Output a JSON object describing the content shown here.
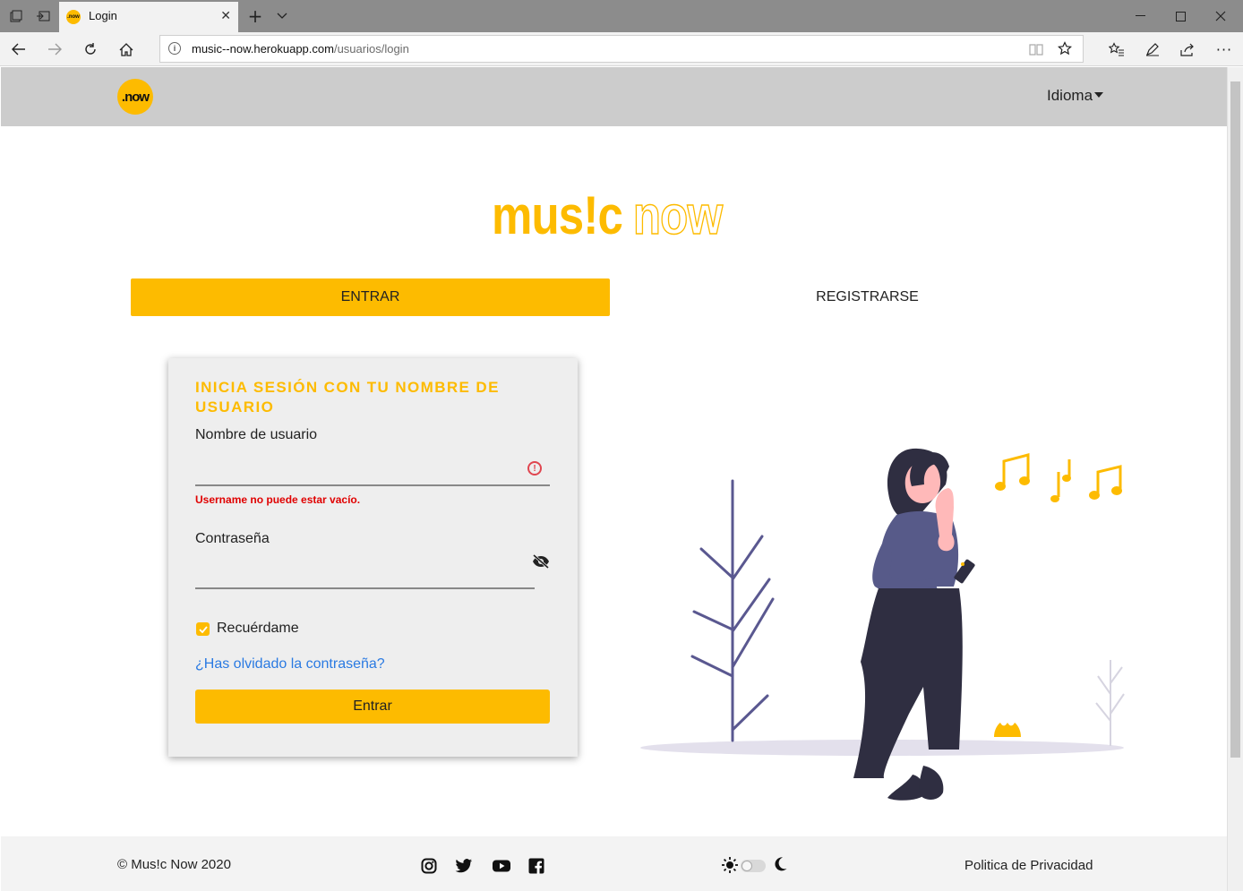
{
  "browser": {
    "tab_title": "Login",
    "favicon_text": ".now",
    "url_domain": "music--now.herokuapp.com",
    "url_path": "/usuarios/login"
  },
  "header": {
    "logo_text": ".now",
    "language_label": "Idioma"
  },
  "brand": {
    "part1": "mus!c",
    "part2": "now"
  },
  "tabs": {
    "login": "ENTRAR",
    "register": "REGISTRARSE"
  },
  "form": {
    "title": "INICIA SESIÓN CON TU NOMBRE DE USUARIO",
    "username_label": "Nombre de usuario",
    "username_value": "",
    "username_error": "Username no puede estar vacío.",
    "password_label": "Contraseña",
    "password_value": "",
    "remember_label": "Recuérdame",
    "remember_checked": true,
    "forgot_link": "¿Has olvidado la contraseña?",
    "submit_label": "Entrar"
  },
  "footer": {
    "copyright": "© Mus!c Now 2020",
    "privacy_link": "Politica de Privacidad",
    "social_icons": [
      "instagram-icon",
      "twitter-icon",
      "youtube-icon",
      "facebook-icon"
    ],
    "theme_toggle_on": false
  },
  "colors": {
    "accent": "#fdbb00",
    "header_bg": "#cccccc",
    "card_bg": "#eeeeee",
    "error": "#e00000",
    "link": "#2a7ae2"
  }
}
